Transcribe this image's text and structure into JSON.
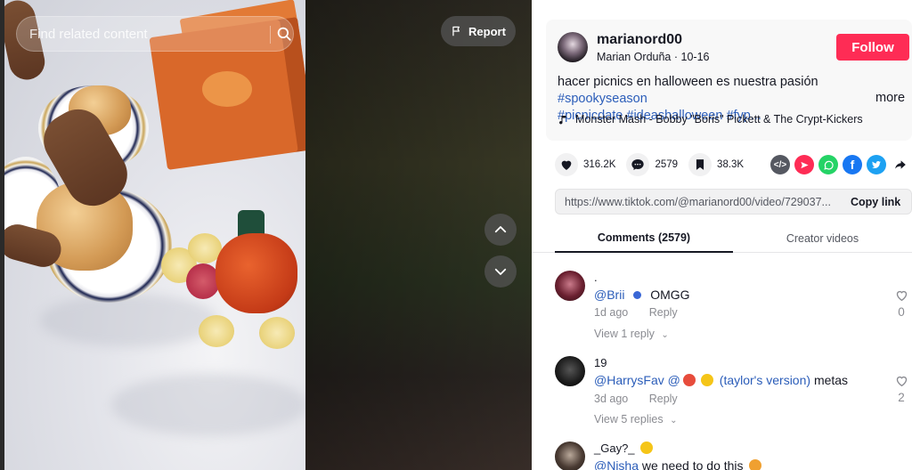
{
  "search": {
    "placeholder": "Find related content"
  },
  "video": {
    "report_label": "Report"
  },
  "author": {
    "username": "marianord00",
    "display_name": "Marian Orduña",
    "date": "10-16",
    "follow_label": "Follow"
  },
  "caption": {
    "text": "hacer picnics en halloween es nuestra pasión",
    "tags": [
      "#spookyseason",
      "#picnicdate",
      "#ideashalloween",
      "#fyp..."
    ],
    "more_label": "more"
  },
  "music": {
    "title": "Monster Mash - Bobby \"Boris\" Pickett & The Crypt-Kickers"
  },
  "stats": {
    "likes": "316.2K",
    "comments": "2579",
    "saves": "38.3K"
  },
  "share": {
    "icons": [
      "embed-icon",
      "send-icon",
      "whatsapp-icon",
      "facebook-icon",
      "twitter-icon",
      "share-arrow-icon"
    ]
  },
  "link": {
    "url": "https://www.tiktok.com/@marianord00/video/729037...",
    "copy_label": "Copy link"
  },
  "tabs": {
    "comments": "Comments (2579)",
    "creator": "Creator videos"
  },
  "comments": [
    {
      "name": ".",
      "mention": "@Brii",
      "text": "OMGG",
      "time": "1d ago",
      "reply_label": "Reply",
      "view_replies": "View 1 reply",
      "likes": "0"
    },
    {
      "name": "19",
      "mention": "@HarrysFav",
      "text_parts": [
        "@",
        "(taylor's version)",
        "metas"
      ],
      "time": "3d ago",
      "reply_label": "Reply",
      "view_replies": "View 5 replies",
      "likes": "2"
    },
    {
      "name": "_Gay?_",
      "mention": "@Nisha",
      "text": "we need to do this"
    }
  ],
  "colors": {
    "follow": "#fe2c55",
    "tag": "#2b5db9",
    "muted": "#8a8b91"
  }
}
